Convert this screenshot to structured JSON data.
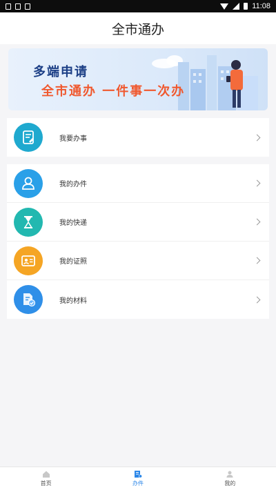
{
  "status_bar": {
    "time": "11:08",
    "icons": [
      "download-icon",
      "sim-icon",
      "a-icon",
      "wifi-icon",
      "signal-icon",
      "battery-icon"
    ]
  },
  "header": {
    "title": "全市通办"
  },
  "banner": {
    "line1": "多端申请",
    "line2": "全市通办  一件事一次办"
  },
  "card_primary": {
    "items": [
      {
        "label": "我要办事",
        "icon": "apply-document-icon",
        "color": "#1fa9cf"
      }
    ]
  },
  "card_secondary": {
    "items": [
      {
        "label": "我的办件",
        "icon": "user-case-icon",
        "color": "#2aa0e8"
      },
      {
        "label": "我的快递",
        "icon": "hourglass-icon",
        "color": "#22b8b0"
      },
      {
        "label": "我的证照",
        "icon": "id-card-icon",
        "color": "#f5a524"
      },
      {
        "label": "我的材料",
        "icon": "materials-icon",
        "color": "#2f8fe8"
      }
    ]
  },
  "bottom_nav": {
    "items": [
      {
        "label": "首页",
        "icon": "home-icon",
        "active": false
      },
      {
        "label": "办件",
        "icon": "case-icon",
        "active": true
      },
      {
        "label": "我的",
        "icon": "profile-icon",
        "active": false
      }
    ]
  },
  "colors": {
    "accent": "#2a86e8",
    "banner_title": "#1c3f86",
    "banner_slogan": "#f0582e"
  }
}
